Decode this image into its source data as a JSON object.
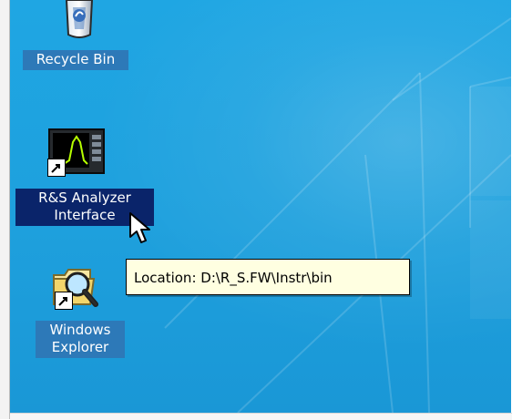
{
  "desktop": {
    "icons": [
      {
        "name": "recycle-bin",
        "label_lines": [
          "Recycle Bin"
        ],
        "selected": false,
        "icon": "recycle-bin-icon"
      },
      {
        "name": "rs-analyzer-interface",
        "label_lines": [
          "R&S Analyzer",
          "Interface"
        ],
        "selected": true,
        "icon": "spectrum-analyzer-icon",
        "shortcut": true
      },
      {
        "name": "windows-explorer",
        "label_lines": [
          "Windows",
          "Explorer"
        ],
        "selected": false,
        "icon": "explorer-magnifier-folder-icon",
        "shortcut": true
      }
    ],
    "tooltip": {
      "text": "Location: D:\\R_S.FW\\Instr\\bin"
    }
  },
  "colors": {
    "desktop_bg": "#1fa6e3",
    "selection_bg": "#0a246a",
    "unselected_label_bg": "#2d79b8",
    "tooltip_bg": "#ffffe1"
  }
}
